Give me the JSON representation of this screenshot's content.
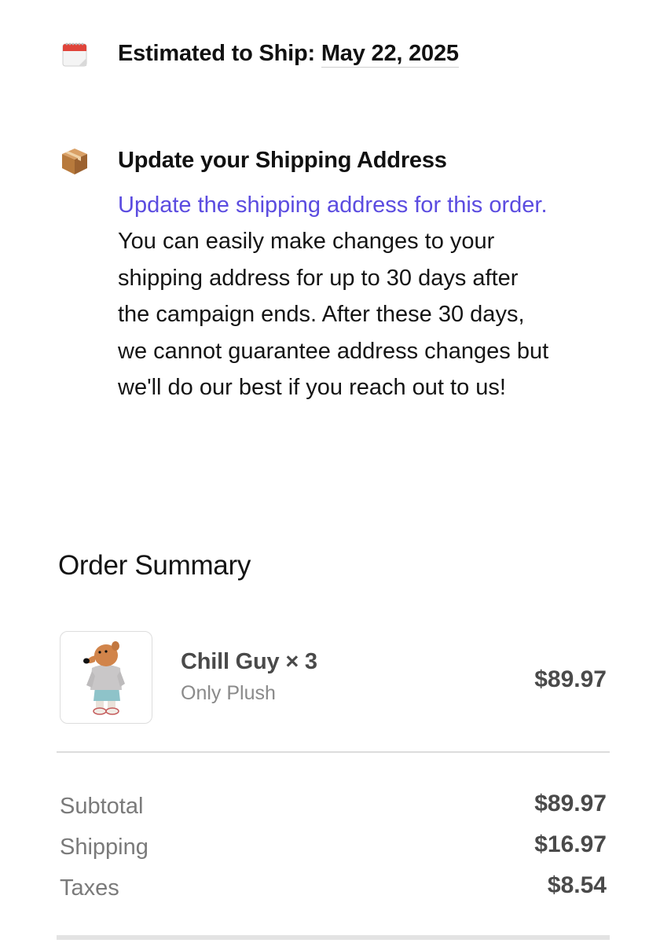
{
  "shipping": {
    "estimate_label": "Estimated to Ship: ",
    "estimate_date": "May 22, 2025",
    "calendar_icon": "calendar-icon"
  },
  "address": {
    "icon": "package-icon",
    "title": "Update your Shipping Address",
    "link_text": "Update the shipping address for this order.",
    "body_lines": [
      "You can easily make changes to your",
      "shipping address for up to 30 days after",
      "the campaign ends. After these 30 days,",
      "we cannot guarantee address changes but",
      "we'll do our best if you reach out to us!"
    ],
    "link_color": "#5B4CE0"
  },
  "summary": {
    "title": "Order Summary",
    "item": {
      "name": "Chill Guy × 3",
      "variant": "Only Plush",
      "price": "$89.97",
      "image": "plush-toy-image"
    },
    "totals": [
      {
        "label": "Subtotal",
        "value": "$89.97"
      },
      {
        "label": "Shipping",
        "value": "$16.97"
      },
      {
        "label": "Taxes",
        "value": "$8.54"
      }
    ]
  }
}
